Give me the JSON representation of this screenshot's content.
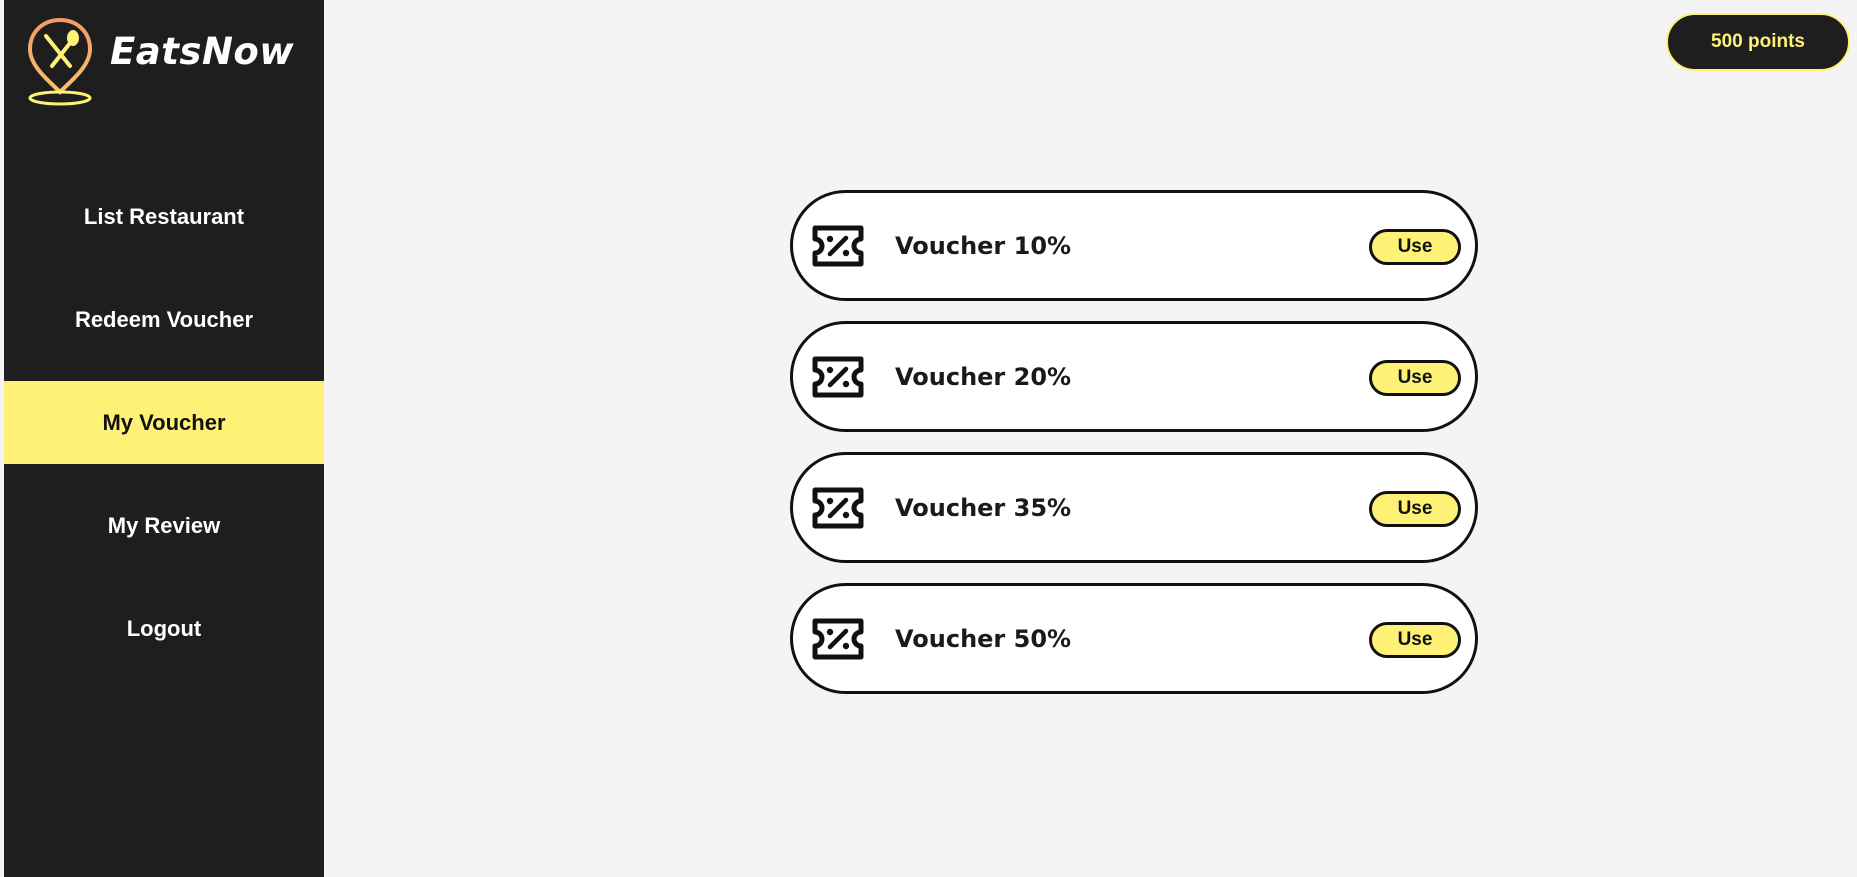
{
  "app": {
    "name": "EatsNow",
    "logo_icon": "map-pin-utensils-icon"
  },
  "sidebar": {
    "items": [
      {
        "label": "List Restaurant",
        "active": false
      },
      {
        "label": "Redeem Voucher",
        "active": false
      },
      {
        "label": "My Voucher",
        "active": true
      },
      {
        "label": "My Review",
        "active": false
      },
      {
        "label": "Logout",
        "active": false
      }
    ]
  },
  "header": {
    "points_label": "500 points"
  },
  "vouchers": {
    "icon": "discount-ticket-icon",
    "use_label": "Use",
    "items": [
      {
        "label": "Voucher 10%"
      },
      {
        "label": "Voucher 20%"
      },
      {
        "label": "Voucher 35%"
      },
      {
        "label": "Voucher 50%"
      }
    ]
  },
  "colors": {
    "sidebar_bg": "#1e1e1e",
    "accent_yellow": "#fff176",
    "page_bg": "#f4f4f4",
    "logo_orange": "#f4a06b"
  }
}
